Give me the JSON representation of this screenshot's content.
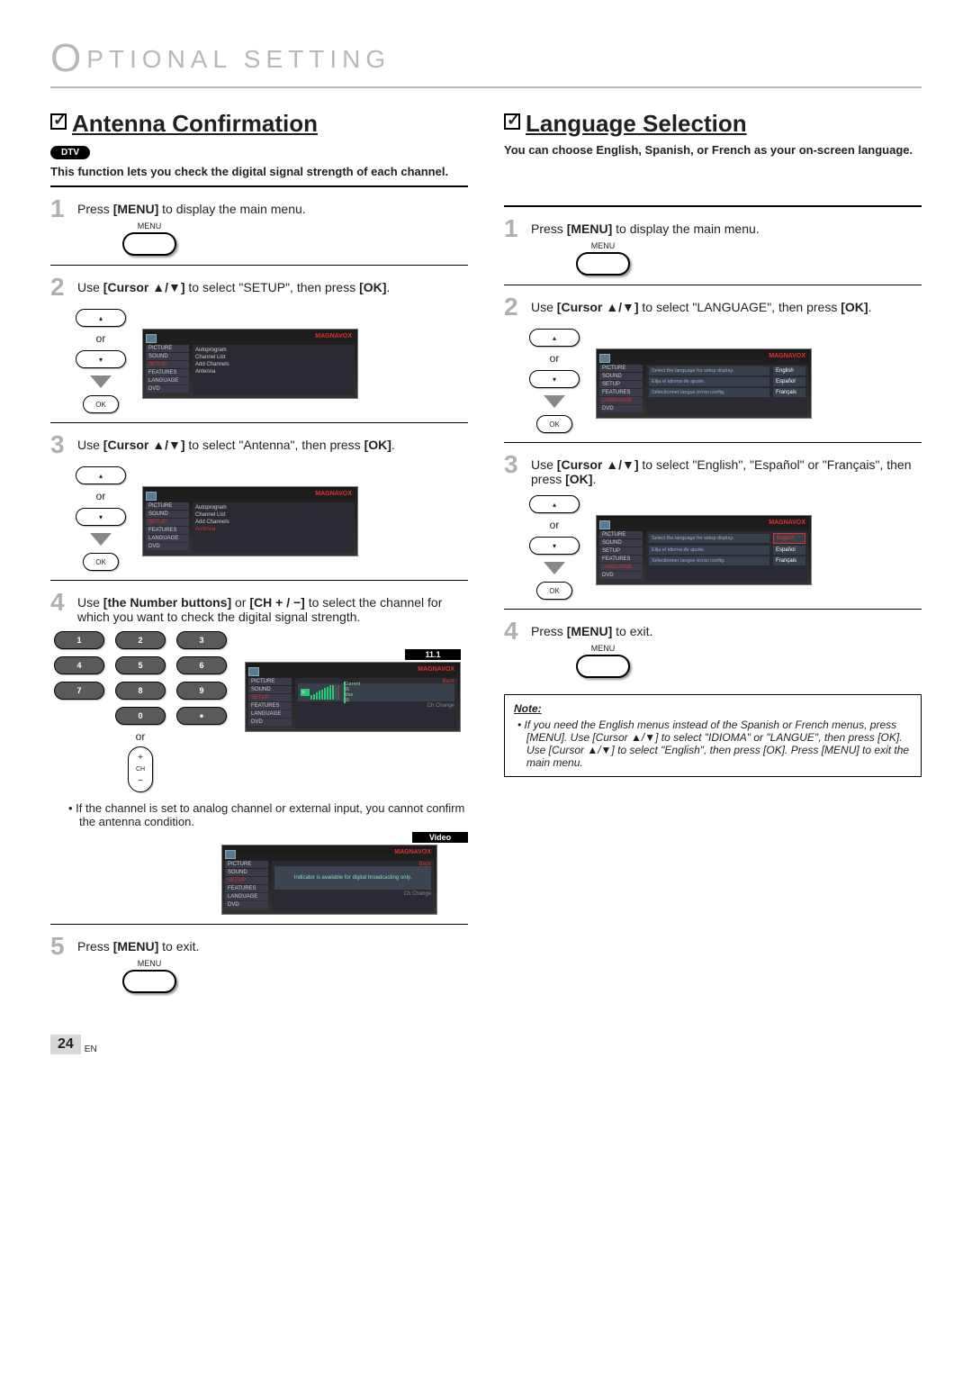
{
  "chapter": {
    "cap": "O",
    "rest": "PTIONAL  SETTING"
  },
  "page_number": "24",
  "page_lang": "EN",
  "left": {
    "title": "Antenna Confirmation",
    "badge": "DTV",
    "intro": "This function lets you check the digital signal strength of each channel.",
    "step1": {
      "num": "1",
      "pre": "Press ",
      "bold": "[MENU]",
      "post": " to display the main menu."
    },
    "menu_label": "MENU",
    "step2": {
      "num": "2",
      "text_parts": [
        "Use ",
        "[Cursor ▲/▼]",
        " to select \"SETUP\", then press ",
        "[OK]",
        "."
      ]
    },
    "or": "or",
    "ok": "OK",
    "tv_setup": {
      "brand": "MAGNAVOX",
      "side": [
        "PICTURE",
        "SOUND",
        "SETUP",
        "FEATURES",
        "LANGUAGE",
        "DVD"
      ],
      "selected": "SETUP",
      "items": [
        "Autoprogram",
        "Channel List",
        "Add Channels",
        "Antenna"
      ]
    },
    "step3": {
      "num": "3",
      "text_parts": [
        "Use ",
        "[Cursor ▲/▼]",
        " to select \"Antenna\", then press ",
        "[OK]",
        "."
      ]
    },
    "tv_antenna": {
      "selected_item": "Antenna"
    },
    "step4": {
      "num": "4",
      "text_parts": [
        "Use ",
        "[the Number buttons]",
        " or ",
        "[CH + / −]",
        " to select the channel for which you want to check the digital signal strength."
      ]
    },
    "keypad": {
      "nums": [
        "1",
        "2",
        "3",
        "4",
        "5",
        "6",
        "7",
        "8",
        "9",
        "0",
        "•"
      ],
      "ch": "CH"
    },
    "channel_tag": "11.1",
    "tv_signal": {
      "brand": "MAGNAVOX",
      "back": "Back",
      "stats": "Current  55  Max      55",
      "footer": "Ch Change"
    },
    "bullet": "If the channel is set to analog channel or external input, you cannot confirm the antenna condition.",
    "video_tag": "Video",
    "tv_video": {
      "brand": "MAGNAVOX",
      "back": "Back",
      "msg": "Indicator is available for digital broadcasting only.",
      "footer": "Ch Change"
    },
    "step5": {
      "num": "5",
      "pre": "Press ",
      "bold": "[MENU]",
      "post": " to exit."
    }
  },
  "right": {
    "title": "Language Selection",
    "intro": "You can choose English, Spanish, or French as your on-screen language.",
    "step1": {
      "num": "1",
      "pre": "Press ",
      "bold": "[MENU]",
      "post": " to display the main menu."
    },
    "menu_label": "MENU",
    "step2": {
      "num": "2",
      "text_parts": [
        "Use ",
        "[Cursor ▲/▼]",
        " to select \"LANGUAGE\", then press ",
        "[OK]",
        "."
      ]
    },
    "tv_lang": {
      "brand": "MAGNAVOX",
      "side": [
        "PICTURE",
        "SOUND",
        "SETUP",
        "FEATURES",
        "LANGUAGE",
        "DVD"
      ],
      "selected": "LANGUAGE",
      "rows": [
        {
          "desc": "Select the language for setup display.",
          "opt": "English"
        },
        {
          "desc": "Elija el idioma de ajuste.",
          "opt": "Español"
        },
        {
          "desc": "Sélectionner langue écran config.",
          "opt": "Français"
        }
      ]
    },
    "step3": {
      "num": "3",
      "text_parts": [
        "Use ",
        "[Cursor ▲/▼]",
        " to select \"English\", \"Español\" or \"Français\", then press ",
        "[OK]",
        "."
      ]
    },
    "step4": {
      "num": "4",
      "pre": "Press ",
      "bold": "[MENU]",
      "post": " to exit."
    },
    "note": {
      "title": "Note:",
      "body": "If you need the English menus instead of the Spanish or French menus, press [MENU]. Use [Cursor ▲/▼] to select \"IDIOMA\" or \"LANGUE\", then press [OK]. Use [Cursor ▲/▼] to select \"English\", then press [OK]. Press [MENU] to exit the main menu."
    },
    "or": "or",
    "ok": "OK"
  }
}
